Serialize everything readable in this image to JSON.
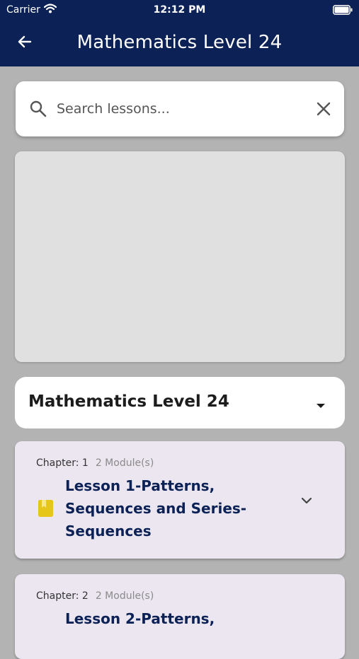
{
  "status_bar": {
    "carrier": "Carrier",
    "time": "12:12 PM",
    "icons": [
      "wifi-icon",
      "battery-icon"
    ]
  },
  "app_bar": {
    "title": "Mathematics Level 24",
    "back_icon": "arrow-left-icon"
  },
  "search": {
    "placeholder": "Search lessons...",
    "value": "",
    "icon": "search-icon",
    "clear_icon": "close-icon"
  },
  "level_selector": {
    "selected": "Mathematics Level 24",
    "icon": "caret-down-icon"
  },
  "lessons": [
    {
      "chapter": "Chapter: 1",
      "modules": "2 Module(s)",
      "title": "Lesson 1-Patterns, Sequences and Series- Sequences",
      "icon": "book-icon"
    },
    {
      "chapter": "Chapter: 2",
      "modules": "2 Module(s)",
      "title": "Lesson 2-Patterns,",
      "icon": "book-icon"
    }
  ],
  "colors": {
    "header": "#0c2257",
    "background": "#b3b3b3",
    "card": "#ece6f0",
    "book_icon": "#e6c619"
  }
}
